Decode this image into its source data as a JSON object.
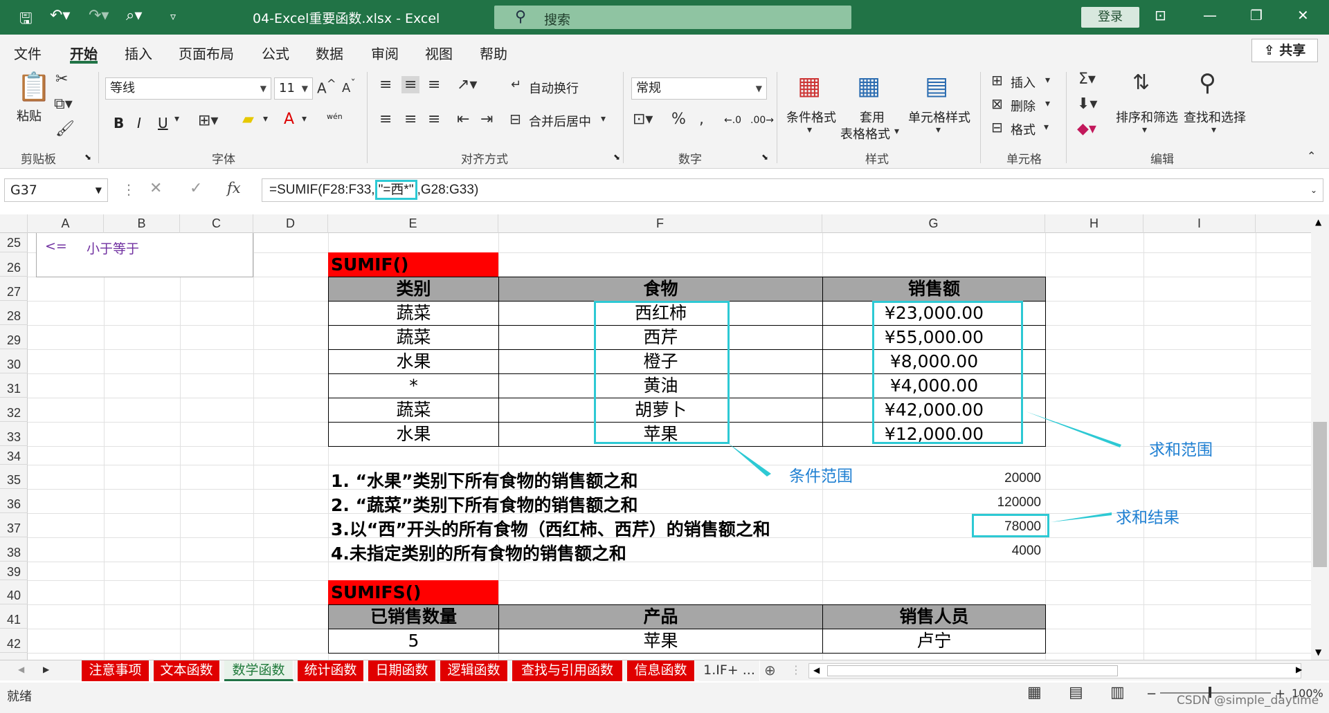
{
  "titlebar": {
    "title": "04-Excel重要函数.xlsx  -  Excel",
    "search_placeholder": "搜索",
    "login": "登录"
  },
  "menu": [
    "文件",
    "开始",
    "插入",
    "页面布局",
    "公式",
    "数据",
    "审阅",
    "视图",
    "帮助"
  ],
  "share": "共享",
  "ribbon": {
    "paste": "粘贴",
    "clipboard": "剪贴板",
    "font_name": "等线",
    "font_size": "11",
    "font_group": "字体",
    "wrap": "自动换行",
    "merge": "合并后居中",
    "align_group": "对齐方式",
    "number_format": "常规",
    "number_group": "数字",
    "cond_format": "条件格式",
    "table_format_1": "套用",
    "table_format_2": "表格格式",
    "cell_style": "单元格样式",
    "style_group": "样式",
    "insert": "插入",
    "delete": "删除",
    "format": "格式",
    "cells_group": "单元格",
    "sort_filter": "排序和筛选",
    "find_select": "查找和选择",
    "edit_group": "编辑",
    "bold": "B",
    "italic": "I",
    "underline": "U",
    "wen": "wén"
  },
  "formula_bar": {
    "name_box": "G37",
    "fx": "fx",
    "formula_pre": "=SUMIF(F28:F33,",
    "formula_hl": "\"=西*\"",
    "formula_post": ",G28:G33)"
  },
  "columns": [
    "A",
    "B",
    "C",
    "D",
    "E",
    "F",
    "G",
    "H",
    "I"
  ],
  "rows": [
    "25",
    "26",
    "27",
    "28",
    "29",
    "30",
    "31",
    "32",
    "33",
    "34",
    "35",
    "36",
    "37",
    "38",
    "39",
    "40",
    "41",
    "42"
  ],
  "tooltip_box": {
    "op": "<=",
    "desc": "小于等于"
  },
  "sumif": {
    "title": "SUMIF()",
    "headers": [
      "类别",
      "食物",
      "销售额"
    ],
    "rows": [
      [
        "蔬菜",
        "西红柿",
        "¥23,000.00"
      ],
      [
        "蔬菜",
        "西芹",
        "¥55,000.00"
      ],
      [
        "水果",
        "橙子",
        "¥8,000.00"
      ],
      [
        "*",
        "黄油",
        "¥4,000.00"
      ],
      [
        "蔬菜",
        "胡萝卜",
        "¥42,000.00"
      ],
      [
        "水果",
        "苹果",
        "¥12,000.00"
      ]
    ]
  },
  "questions": [
    {
      "text": "1. “水果”类别下所有食物的销售额之和",
      "result": "20000"
    },
    {
      "text": "2. “蔬菜”类别下所有食物的销售额之和",
      "result": "120000"
    },
    {
      "text": "3.以“西”开头的所有食物（西红柿、西芹）的销售额之和",
      "result": "78000"
    },
    {
      "text": "4.未指定类别的所有食物的销售额之和",
      "result": "4000"
    }
  ],
  "annotations": {
    "cond_range": "条件范围",
    "sum_range": "求和范围",
    "sum_result": "求和结果"
  },
  "sumifs": {
    "title": "SUMIFS()",
    "headers": [
      "已销售数量",
      "产品",
      "销售人员"
    ],
    "row": [
      "5",
      "苹果",
      "卢宁"
    ]
  },
  "sheets": [
    "注意事项",
    "文本函数",
    "数学函数",
    "统计函数",
    "日期函数",
    "逻辑函数",
    "查找与引用函数",
    "信息函数",
    "1.IF+ ..."
  ],
  "active_sheet": "数学函数",
  "status": {
    "ready": "就绪",
    "zoom": "100%",
    "watermark": "CSDN @simple_daytime"
  },
  "colors": {
    "excel_green": "#217346",
    "header_red": "#ff0000",
    "table_header_gray": "#a6a6a6",
    "highlight_cyan": "#2dc9d4",
    "annotation_blue": "#1e7fd2"
  }
}
